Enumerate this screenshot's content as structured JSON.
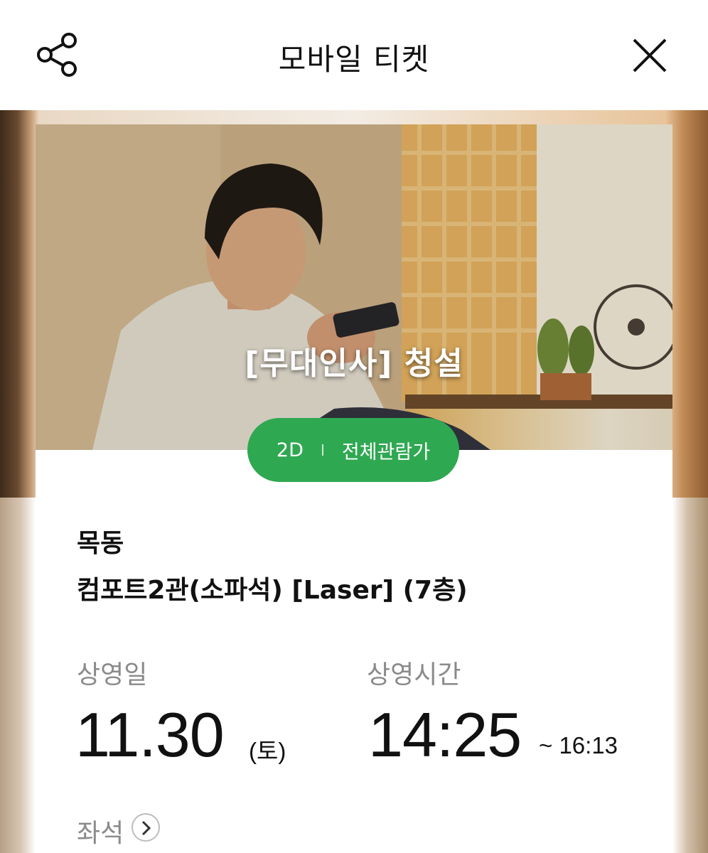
{
  "header": {
    "title": "모바일 티켓",
    "share_icon": "share-icon",
    "close_icon": "close-icon"
  },
  "ticket": {
    "movie_title": "[무대인사] 청설",
    "format": "2D",
    "rating": "전체관람가",
    "theater": "목동",
    "screen": "컴포트2관(소파석) [Laser] (7층)",
    "date_label": "상영일",
    "date": "11.30",
    "weekday": "(토)",
    "time_label": "상영시간",
    "start_time": "14:25",
    "end_time": "~ 16:13",
    "seat_label": "좌석",
    "seat_icon": "chevron-right-icon"
  },
  "colors": {
    "accent_green": "#2fa852",
    "label_gray": "#8a8a8a"
  }
}
